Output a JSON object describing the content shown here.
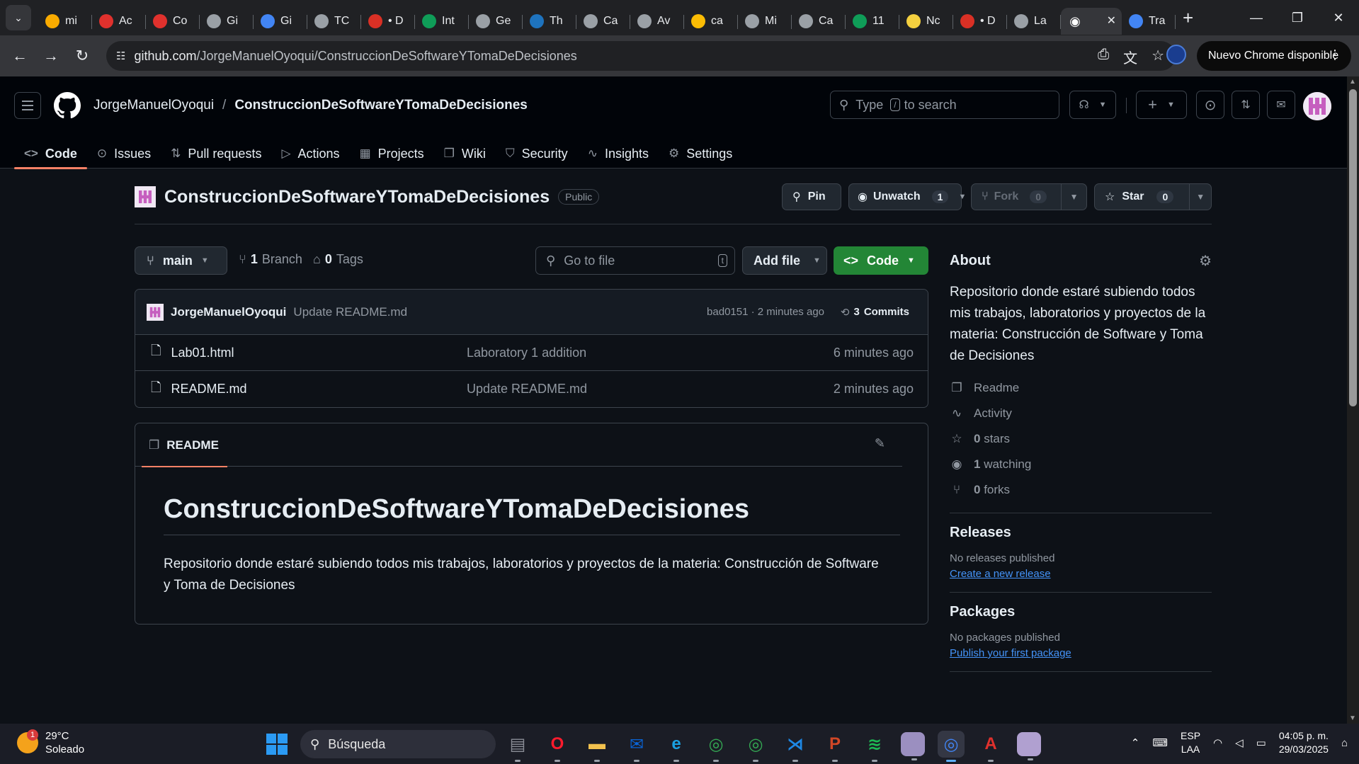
{
  "browser": {
    "tabs": [
      {
        "label": "mi",
        "icon": "chart-bars-icon",
        "color": "#f9ab00"
      },
      {
        "label": "Ac",
        "icon": "adobe-icon",
        "color": "#e0312d"
      },
      {
        "label": "Co",
        "icon": "adobe-icon",
        "color": "#e0312d"
      },
      {
        "label": "Gi",
        "icon": "globe-icon",
        "color": "#9aa0a6"
      },
      {
        "label": "Gi",
        "icon": "triangle-icon",
        "color": "#4285f4"
      },
      {
        "label": "TC",
        "icon": "globe-icon",
        "color": "#9aa0a6"
      },
      {
        "label": "• D",
        "icon": "app-icon",
        "color": "#d93025"
      },
      {
        "label": "Int",
        "icon": "sheets-icon",
        "color": "#0f9d58"
      },
      {
        "label": "Ge",
        "icon": "github-icon",
        "color": "#9aa0a6"
      },
      {
        "label": "Th",
        "icon": "w3-icon",
        "color": "#1e73be"
      },
      {
        "label": "Ca",
        "icon": "globe-icon",
        "color": "#9aa0a6"
      },
      {
        "label": "Av",
        "icon": "globe-icon",
        "color": "#9aa0a6"
      },
      {
        "label": "ca",
        "icon": "drive-icon",
        "color": "#fbbc04"
      },
      {
        "label": "Mi",
        "icon": "globe-icon",
        "color": "#9aa0a6"
      },
      {
        "label": "Ca",
        "icon": "globe-icon",
        "color": "#9aa0a6"
      },
      {
        "label": "11",
        "icon": "plus-sheet-icon",
        "color": "#0f9d58"
      },
      {
        "label": "Nc",
        "icon": "hex-icon",
        "color": "#f4d03f"
      },
      {
        "label": "• D",
        "icon": "app-icon",
        "color": "#d93025"
      },
      {
        "label": "La",
        "icon": "globe-icon",
        "color": "#9aa0a6"
      },
      {
        "label": "",
        "icon": "github-icon",
        "color": "#ffffff",
        "active": true
      },
      {
        "label": "Tra",
        "icon": "translate-icon",
        "color": "#4285f4"
      }
    ],
    "url_host": "github.com",
    "url_path": "/JorgeManuelOyoqui/ConstruccionDeSoftwareYTomaDeDecisiones",
    "update_label": "Nuevo Chrome disponible"
  },
  "github": {
    "owner": "JorgeManuelOyoqui",
    "slash": "/",
    "repo": "ConstruccionDeSoftwareYTomaDeDecisiones",
    "search_prefix": "Type",
    "search_key": "/",
    "search_suffix": "to search",
    "nav": [
      {
        "label": "Code",
        "icon": "code-icon",
        "glyph": "<>",
        "active": true
      },
      {
        "label": "Issues",
        "icon": "issue-icon",
        "glyph": "⊙"
      },
      {
        "label": "Pull requests",
        "icon": "pull-request-icon",
        "glyph": "⇅"
      },
      {
        "label": "Actions",
        "icon": "play-icon",
        "glyph": "▷"
      },
      {
        "label": "Projects",
        "icon": "table-icon",
        "glyph": "▦"
      },
      {
        "label": "Wiki",
        "icon": "book-icon",
        "glyph": "❐"
      },
      {
        "label": "Security",
        "icon": "shield-icon",
        "glyph": "⛉"
      },
      {
        "label": "Insights",
        "icon": "graph-icon",
        "glyph": "∿"
      },
      {
        "label": "Settings",
        "icon": "gear-icon",
        "glyph": "⚙"
      }
    ]
  },
  "repo": {
    "name": "ConstruccionDeSoftwareYTomaDeDecisiones",
    "visibility": "Public",
    "pin": "Pin",
    "unwatch": "Unwatch",
    "watch_count": "1",
    "fork": "Fork",
    "fork_count": "0",
    "star": "Star",
    "star_count": "0",
    "branch": "main",
    "branches_count": "1",
    "branches_label": "Branch",
    "tags_count": "0",
    "tags_label": "Tags",
    "goto_placeholder": "Go to file",
    "goto_key": "t",
    "add_file": "Add file",
    "code_btn": "Code"
  },
  "commit": {
    "author": "JorgeManuelOyoqui",
    "message": "Update README.md",
    "sha_time": "bad0151 · 2 minutes ago",
    "commits_count": "3",
    "commits_label": "Commits"
  },
  "files": [
    {
      "name": "Lab01.html",
      "message": "Laboratory 1 addition",
      "time": "6 minutes ago"
    },
    {
      "name": "README.md",
      "message": "Update README.md",
      "time": "2 minutes ago"
    }
  ],
  "readme": {
    "tab": "README",
    "title": "ConstruccionDeSoftwareYTomaDeDecisiones",
    "body": "Repositorio donde estaré subiendo todos mis trabajos, laboratorios y proyectos de la materia: Construcción de Software y Toma de Decisiones"
  },
  "about": {
    "title": "About",
    "description": "Repositorio donde estaré subiendo todos mis trabajos, laboratorios y proyectos de la materia: Construcción de Software y Toma de Decisiones",
    "items": [
      {
        "count": "",
        "label": "Readme",
        "icon": "book-icon",
        "glyph": "❐"
      },
      {
        "count": "",
        "label": "Activity",
        "icon": "pulse-icon",
        "glyph": "∿"
      },
      {
        "count": "0",
        "label": "stars",
        "icon": "star-icon",
        "glyph": "☆"
      },
      {
        "count": "1",
        "label": "watching",
        "icon": "eye-icon",
        "glyph": "◉"
      },
      {
        "count": "0",
        "label": "forks",
        "icon": "fork-icon",
        "glyph": "⑂"
      }
    ],
    "releases_title": "Releases",
    "releases_text": "No releases published",
    "releases_link": "Create a new release",
    "packages_title": "Packages",
    "packages_text": "No packages published",
    "packages_link": "Publish your first package"
  },
  "taskbar": {
    "temp": "29°C",
    "condition": "Soleado",
    "notif_count": "1",
    "search": "Búsqueda",
    "lang_top": "ESP",
    "lang_bottom": "LAA",
    "time": "04:05 p. m.",
    "date": "29/03/2025",
    "apps": [
      {
        "name": "file-manager-icon",
        "color": "#8a8d96",
        "glyph": "▤"
      },
      {
        "name": "opera-icon",
        "color": "#ff1b2d",
        "glyph": "O"
      },
      {
        "name": "folder-icon",
        "color": "#f2c14e",
        "glyph": "▬"
      },
      {
        "name": "outlook-icon",
        "color": "#0a64d6",
        "glyph": "✉"
      },
      {
        "name": "edge-icon",
        "color": "#1aa0e0",
        "glyph": "e"
      },
      {
        "name": "chrome-icon",
        "color": "#34a853",
        "glyph": "◎"
      },
      {
        "name": "chrome-profile-icon",
        "color": "#34a853",
        "glyph": "◎"
      },
      {
        "name": "vscode-icon",
        "color": "#1e88e5",
        "glyph": "⋊"
      },
      {
        "name": "powerpoint-icon",
        "color": "#d24726",
        "glyph": "P"
      },
      {
        "name": "spotify-icon",
        "color": "#1db954",
        "glyph": "≋"
      },
      {
        "name": "app-tile-icon",
        "color": "#9b8fc0",
        "glyph": ""
      },
      {
        "name": "chrome-active-icon",
        "color": "#4285f4",
        "glyph": "◎",
        "focused": true
      },
      {
        "name": "acrobat-icon",
        "color": "#e0312d",
        "glyph": "A"
      },
      {
        "name": "app-tile-2-icon",
        "color": "#b0a0d0",
        "glyph": ""
      }
    ]
  }
}
